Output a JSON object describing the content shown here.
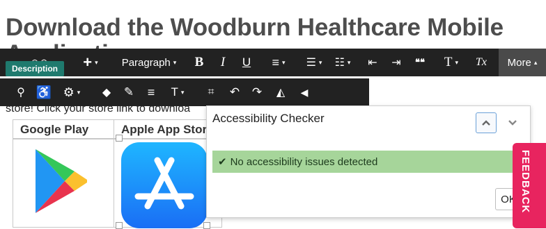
{
  "page": {
    "heading": "Download the Woodburn Healthcare Mobile",
    "heading_line2": "Application",
    "store_text": "store! Click your store link to downloa",
    "description_badge": "Description"
  },
  "toolbar": {
    "row1": [
      {
        "name": "add-button",
        "label": "+",
        "caret": true
      },
      {
        "name": "paragraph-format-select",
        "label": "Paragraph",
        "caret": true
      },
      {
        "name": "bold-button",
        "label": "B"
      },
      {
        "name": "italic-button",
        "label": "I"
      },
      {
        "name": "underline-button",
        "label": "U"
      },
      {
        "name": "align-button",
        "label": "≡",
        "caret": true
      },
      {
        "name": "bullet-list-button",
        "label": "☰",
        "caret": true
      },
      {
        "name": "numbered-list-button",
        "label": "☷",
        "caret": true
      },
      {
        "name": "outdent-button",
        "label": "⇤"
      },
      {
        "name": "indent-button",
        "label": "⇥"
      },
      {
        "name": "quote-button",
        "label": "❝❝"
      },
      {
        "name": "font-size-button",
        "label": "T",
        "caret": true
      },
      {
        "name": "clear-format-button",
        "label": "Tx"
      }
    ],
    "more_label": "More",
    "row2": [
      {
        "name": "search-button",
        "label": "⚲"
      },
      {
        "name": "accessibility-button",
        "label": "♿"
      },
      {
        "name": "settings-button",
        "label": "⚙",
        "caret": true
      },
      {
        "name": "fill-color-button",
        "label": "◆"
      },
      {
        "name": "pen-button",
        "label": "✎"
      },
      {
        "name": "line-align-button",
        "label": "≡"
      },
      {
        "name": "text-height-button",
        "label": "T",
        "caret": true
      },
      {
        "name": "crop-button",
        "label": "⌗"
      },
      {
        "name": "undo-button",
        "label": "↶"
      },
      {
        "name": "redo-button",
        "label": "↷"
      },
      {
        "name": "flip-horizontal-button",
        "label": "◭"
      },
      {
        "name": "flip-arrow-button",
        "label": "◀"
      }
    ]
  },
  "table": {
    "headers": [
      "Google Play",
      "Apple App Stor"
    ]
  },
  "checker": {
    "title": "Accessibility Checker",
    "message": "No accessibility issues detected",
    "ok_label": "OK"
  },
  "feedback": {
    "label": "FEEDBACK"
  },
  "colors": {
    "toolbar_bg": "#222222",
    "badge_bg": "#1f7a6e",
    "success_bg": "#a6d59a",
    "feedback_bg": "#e8245f"
  }
}
